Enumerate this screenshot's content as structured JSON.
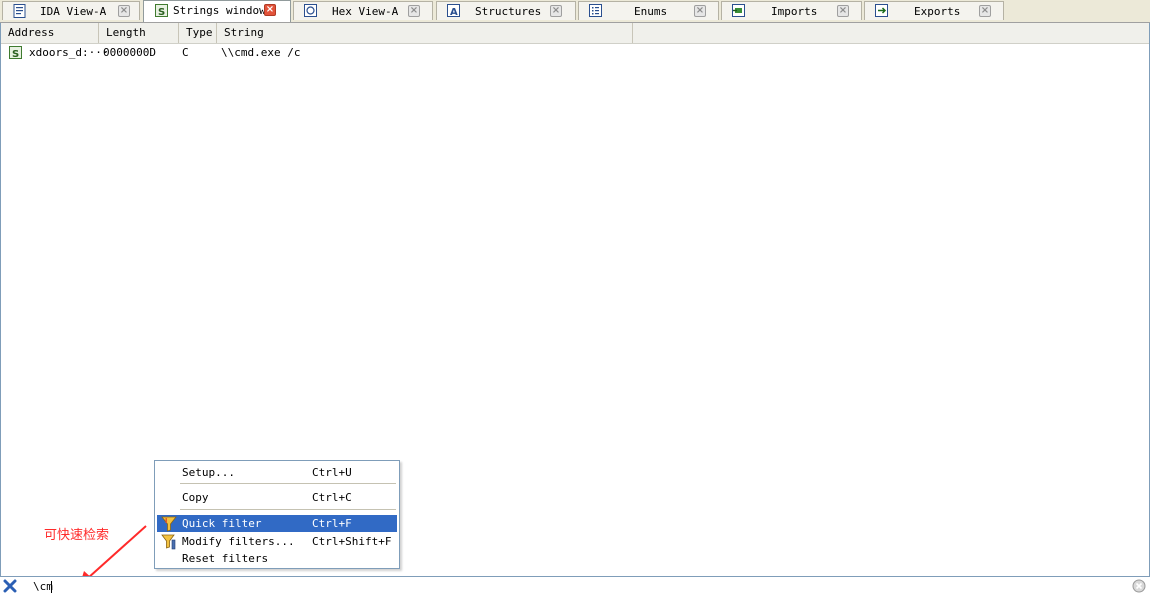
{
  "tabs": [
    {
      "label": "IDA View-A",
      "icon": "ida-view-icon",
      "active": false
    },
    {
      "label": "Strings window",
      "icon": "strings-icon",
      "active": true
    },
    {
      "label": "Hex View-A",
      "icon": "hex-view-icon",
      "active": false
    },
    {
      "label": "Structures",
      "icon": "structures-icon",
      "active": false
    },
    {
      "label": "Enums",
      "icon": "enums-icon",
      "active": false
    },
    {
      "label": "Imports",
      "icon": "imports-icon",
      "active": false
    },
    {
      "label": "Exports",
      "icon": "exports-icon",
      "active": false
    }
  ],
  "table": {
    "columns": [
      "Address",
      "Length",
      "Type",
      "String"
    ],
    "rows": [
      {
        "address": "xdoors_d:···",
        "length": "0000000D",
        "type": "C",
        "string": "\\\\cmd.exe /c"
      }
    ]
  },
  "context_menu": {
    "items": [
      {
        "label": "Setup...",
        "shortcut": "Ctrl+U"
      },
      {
        "label": "Copy",
        "shortcut": "Ctrl+C"
      },
      {
        "label": "Quick filter",
        "shortcut": "Ctrl+F",
        "highlighted": true
      },
      {
        "label": "Modify filters...",
        "shortcut": "Ctrl+Shift+F"
      },
      {
        "label": "Reset filters",
        "shortcut": ""
      }
    ]
  },
  "filter": {
    "value": "\\cm"
  },
  "annotation": {
    "text": "可快速检索",
    "color": "#ff2a2a"
  },
  "colors": {
    "highlight": "#316ac5",
    "border": "#7f9db9",
    "tabbar": "#ece9d8"
  }
}
